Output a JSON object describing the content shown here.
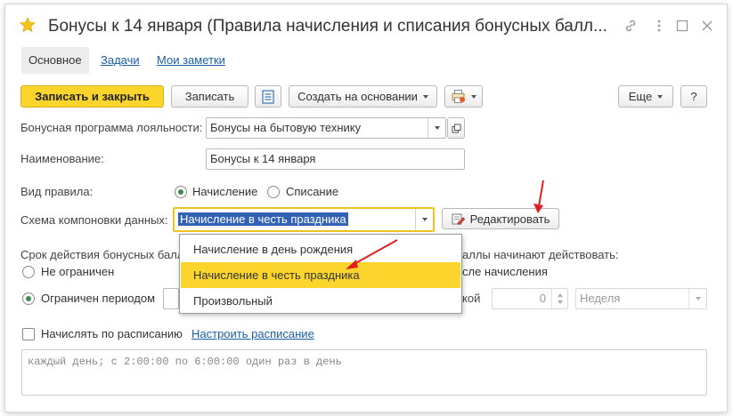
{
  "window": {
    "title": "Бонусы к 14 января (Правила начисления и списания бонусных балл...",
    "title_icons": [
      "star-icon",
      "link-icon",
      "more-icon",
      "maximize-icon",
      "close-icon"
    ]
  },
  "tabs": [
    {
      "label": "Основное",
      "active": true
    },
    {
      "label": "Задачи",
      "active": false
    },
    {
      "label": "Мои заметки",
      "active": false
    }
  ],
  "toolbar": {
    "save_close_label": "Записать и закрыть",
    "save_label": "Записать",
    "create_based_label": "Создать на основании",
    "more_label": "Еще",
    "help_label": "?"
  },
  "form": {
    "program_label": "Бонусная программа лояльности:",
    "program_value": "Бонусы на бытовую технику",
    "name_label": "Наименование:",
    "name_value": "Бонусы к 14 января",
    "rule_type_label": "Вид правила:",
    "rule_type_options": [
      "Начисление",
      "Списание"
    ],
    "rule_type_selected": "Начисление",
    "schema_label": "Схема компоновки данных:",
    "schema_value": "Начисление в честь праздника",
    "edit_label": "Редактировать",
    "validity_label": "Срок действия бонусных балл",
    "validity_right_label": "аллы начинают действовать:",
    "unlimited_label": "Не ограничен",
    "after_accrual_label": "сле начисления",
    "limited_label": "Ограничен периодом",
    "koi_label": "кой",
    "period_number": "0",
    "period_unit": "Неделя",
    "schedule_label": "Начислять по расписанию",
    "schedule_link": "Настроить расписание",
    "schedule_text": "каждый день; с 2:00:00 по 6:00:00 один раз в день"
  },
  "dropdown": {
    "items": [
      "Начисление в день рождения",
      "Начисление в честь праздника",
      "Произвольный"
    ],
    "highlighted": "Начисление в честь праздника"
  },
  "colors": {
    "accent_yellow": "#fbd52c",
    "link_blue": "#1a5fa8",
    "radio_green": "#3d8c4f",
    "arrow_red": "#e02020",
    "selection_blue": "#3162b5"
  }
}
